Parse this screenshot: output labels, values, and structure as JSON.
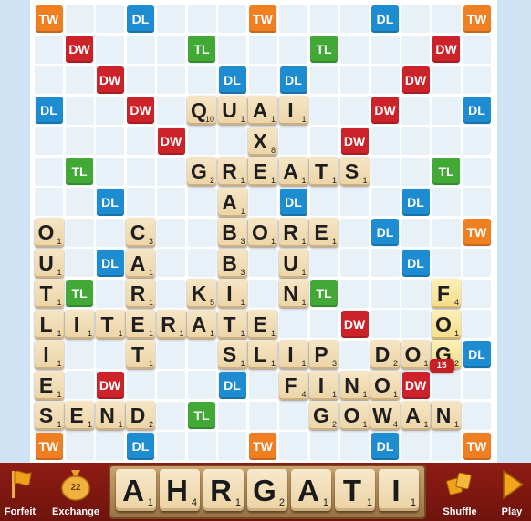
{
  "colors": {
    "TW": "#f07f21",
    "DW": "#cc2229",
    "TL": "#42a836",
    "DL": "#1d8cd0"
  },
  "premium_labels": {
    "TW": "TW",
    "DW": "DW",
    "TL": "TL",
    "DL": "DL"
  },
  "board": {
    "premiums": [
      {
        "r": 0,
        "c": 0,
        "t": "TW"
      },
      {
        "r": 0,
        "c": 3,
        "t": "DL"
      },
      {
        "r": 0,
        "c": 7,
        "t": "TW"
      },
      {
        "r": 0,
        "c": 11,
        "t": "DL"
      },
      {
        "r": 0,
        "c": 14,
        "t": "TW"
      },
      {
        "r": 1,
        "c": 1,
        "t": "DW"
      },
      {
        "r": 1,
        "c": 5,
        "t": "TL"
      },
      {
        "r": 1,
        "c": 9,
        "t": "TL"
      },
      {
        "r": 1,
        "c": 13,
        "t": "DW"
      },
      {
        "r": 2,
        "c": 2,
        "t": "DW"
      },
      {
        "r": 2,
        "c": 6,
        "t": "DL"
      },
      {
        "r": 2,
        "c": 8,
        "t": "DL"
      },
      {
        "r": 2,
        "c": 12,
        "t": "DW"
      },
      {
        "r": 3,
        "c": 0,
        "t": "DL"
      },
      {
        "r": 3,
        "c": 3,
        "t": "DW"
      },
      {
        "r": 3,
        "c": 11,
        "t": "DW"
      },
      {
        "r": 3,
        "c": 14,
        "t": "DL"
      },
      {
        "r": 4,
        "c": 4,
        "t": "DW"
      },
      {
        "r": 4,
        "c": 10,
        "t": "DW"
      },
      {
        "r": 5,
        "c": 1,
        "t": "TL"
      },
      {
        "r": 5,
        "c": 13,
        "t": "TL"
      },
      {
        "r": 6,
        "c": 2,
        "t": "DL"
      },
      {
        "r": 6,
        "c": 8,
        "t": "DL"
      },
      {
        "r": 6,
        "c": 12,
        "t": "DL"
      },
      {
        "r": 7,
        "c": 11,
        "t": "DL"
      },
      {
        "r": 7,
        "c": 14,
        "t": "TW"
      },
      {
        "r": 8,
        "c": 2,
        "t": "DL"
      },
      {
        "r": 8,
        "c": 12,
        "t": "DL"
      },
      {
        "r": 9,
        "c": 1,
        "t": "TL"
      },
      {
        "r": 9,
        "c": 9,
        "t": "TL"
      },
      {
        "r": 10,
        "c": 10,
        "t": "DW"
      },
      {
        "r": 11,
        "c": 14,
        "t": "DL"
      },
      {
        "r": 12,
        "c": 2,
        "t": "DW"
      },
      {
        "r": 12,
        "c": 6,
        "t": "DL"
      },
      {
        "r": 12,
        "c": 12,
        "t": "DW"
      },
      {
        "r": 13,
        "c": 5,
        "t": "TL"
      },
      {
        "r": 14,
        "c": 0,
        "t": "TW"
      },
      {
        "r": 14,
        "c": 3,
        "t": "DL"
      },
      {
        "r": 14,
        "c": 7,
        "t": "TW"
      },
      {
        "r": 14,
        "c": 11,
        "t": "DL"
      },
      {
        "r": 14,
        "c": 14,
        "t": "TW"
      }
    ],
    "tiles": [
      {
        "r": 3,
        "c": 5,
        "l": "Q",
        "p": "10"
      },
      {
        "r": 3,
        "c": 6,
        "l": "U",
        "p": "1"
      },
      {
        "r": 3,
        "c": 7,
        "l": "A",
        "p": "1"
      },
      {
        "r": 3,
        "c": 8,
        "l": "I",
        "p": "1"
      },
      {
        "r": 4,
        "c": 7,
        "l": "X",
        "p": "8"
      },
      {
        "r": 5,
        "c": 5,
        "l": "G",
        "p": "2"
      },
      {
        "r": 5,
        "c": 6,
        "l": "R",
        "p": "1"
      },
      {
        "r": 5,
        "c": 7,
        "l": "E",
        "p": "1"
      },
      {
        "r": 5,
        "c": 8,
        "l": "A",
        "p": "1"
      },
      {
        "r": 5,
        "c": 9,
        "l": "T",
        "p": "1"
      },
      {
        "r": 5,
        "c": 10,
        "l": "S",
        "p": "1"
      },
      {
        "r": 6,
        "c": 6,
        "l": "A",
        "p": "1"
      },
      {
        "r": 7,
        "c": 0,
        "l": "O",
        "p": "1"
      },
      {
        "r": 7,
        "c": 3,
        "l": "C",
        "p": "3"
      },
      {
        "r": 7,
        "c": 6,
        "l": "B",
        "p": "3"
      },
      {
        "r": 7,
        "c": 7,
        "l": "O",
        "p": "1"
      },
      {
        "r": 7,
        "c": 8,
        "l": "R",
        "p": "1"
      },
      {
        "r": 7,
        "c": 9,
        "l": "E",
        "p": "1"
      },
      {
        "r": 8,
        "c": 0,
        "l": "U",
        "p": "1"
      },
      {
        "r": 8,
        "c": 3,
        "l": "A",
        "p": "1"
      },
      {
        "r": 8,
        "c": 6,
        "l": "B",
        "p": "3"
      },
      {
        "r": 8,
        "c": 8,
        "l": "U",
        "p": "1"
      },
      {
        "r": 9,
        "c": 0,
        "l": "T",
        "p": "1"
      },
      {
        "r": 9,
        "c": 3,
        "l": "R",
        "p": "1"
      },
      {
        "r": 9,
        "c": 5,
        "l": "K",
        "p": "5"
      },
      {
        "r": 9,
        "c": 6,
        "l": "I",
        "p": "1"
      },
      {
        "r": 9,
        "c": 8,
        "l": "N",
        "p": "1"
      },
      {
        "r": 10,
        "c": 0,
        "l": "L",
        "p": "1"
      },
      {
        "r": 10,
        "c": 1,
        "l": "I",
        "p": "1"
      },
      {
        "r": 10,
        "c": 2,
        "l": "T",
        "p": "1"
      },
      {
        "r": 10,
        "c": 3,
        "l": "E",
        "p": "1"
      },
      {
        "r": 10,
        "c": 4,
        "l": "R",
        "p": "1"
      },
      {
        "r": 10,
        "c": 5,
        "l": "A",
        "p": "1"
      },
      {
        "r": 10,
        "c": 6,
        "l": "T",
        "p": "1"
      },
      {
        "r": 10,
        "c": 7,
        "l": "E",
        "p": "1"
      },
      {
        "r": 11,
        "c": 0,
        "l": "I",
        "p": "1"
      },
      {
        "r": 11,
        "c": 3,
        "l": "T",
        "p": "1"
      },
      {
        "r": 11,
        "c": 6,
        "l": "S",
        "p": "1"
      },
      {
        "r": 11,
        "c": 7,
        "l": "L",
        "p": "1"
      },
      {
        "r": 11,
        "c": 8,
        "l": "I",
        "p": "1"
      },
      {
        "r": 11,
        "c": 9,
        "l": "P",
        "p": "3"
      },
      {
        "r": 11,
        "c": 11,
        "l": "D",
        "p": "2"
      },
      {
        "r": 11,
        "c": 12,
        "l": "O",
        "p": "1"
      },
      {
        "r": 12,
        "c": 0,
        "l": "E",
        "p": "1"
      },
      {
        "r": 12,
        "c": 8,
        "l": "F",
        "p": "4"
      },
      {
        "r": 12,
        "c": 9,
        "l": "I",
        "p": "1"
      },
      {
        "r": 12,
        "c": 10,
        "l": "N",
        "p": "1"
      },
      {
        "r": 12,
        "c": 11,
        "l": "O",
        "p": "1"
      },
      {
        "r": 13,
        "c": 0,
        "l": "S",
        "p": "1"
      },
      {
        "r": 13,
        "c": 1,
        "l": "E",
        "p": "1"
      },
      {
        "r": 13,
        "c": 2,
        "l": "N",
        "p": "1"
      },
      {
        "r": 13,
        "c": 3,
        "l": "D",
        "p": "2"
      },
      {
        "r": 13,
        "c": 9,
        "l": "G",
        "p": "2"
      },
      {
        "r": 13,
        "c": 10,
        "l": "O",
        "p": "1"
      },
      {
        "r": 13,
        "c": 11,
        "l": "W",
        "p": "4"
      },
      {
        "r": 13,
        "c": 12,
        "l": "A",
        "p": "1"
      },
      {
        "r": 13,
        "c": 13,
        "l": "N",
        "p": "1"
      },
      {
        "r": 9,
        "c": 13,
        "l": "F",
        "p": "4",
        "new": true
      },
      {
        "r": 10,
        "c": 13,
        "l": "O",
        "p": "1",
        "new": true
      },
      {
        "r": 11,
        "c": 13,
        "l": "G",
        "p": "2",
        "new": true
      }
    ],
    "score_badge": "15"
  },
  "toolbar": {
    "forfeit_label": "Forfeit",
    "exchange_label": "Exchange",
    "bag_count": "22",
    "shuffle_label": "Shuffle",
    "play_label": "Play"
  },
  "rack": [
    {
      "l": "A",
      "p": "1"
    },
    {
      "l": "H",
      "p": "4"
    },
    {
      "l": "R",
      "p": "1"
    },
    {
      "l": "G",
      "p": "2"
    },
    {
      "l": "A",
      "p": "1"
    },
    {
      "l": "T",
      "p": "1"
    },
    {
      "l": "I",
      "p": "1"
    }
  ]
}
